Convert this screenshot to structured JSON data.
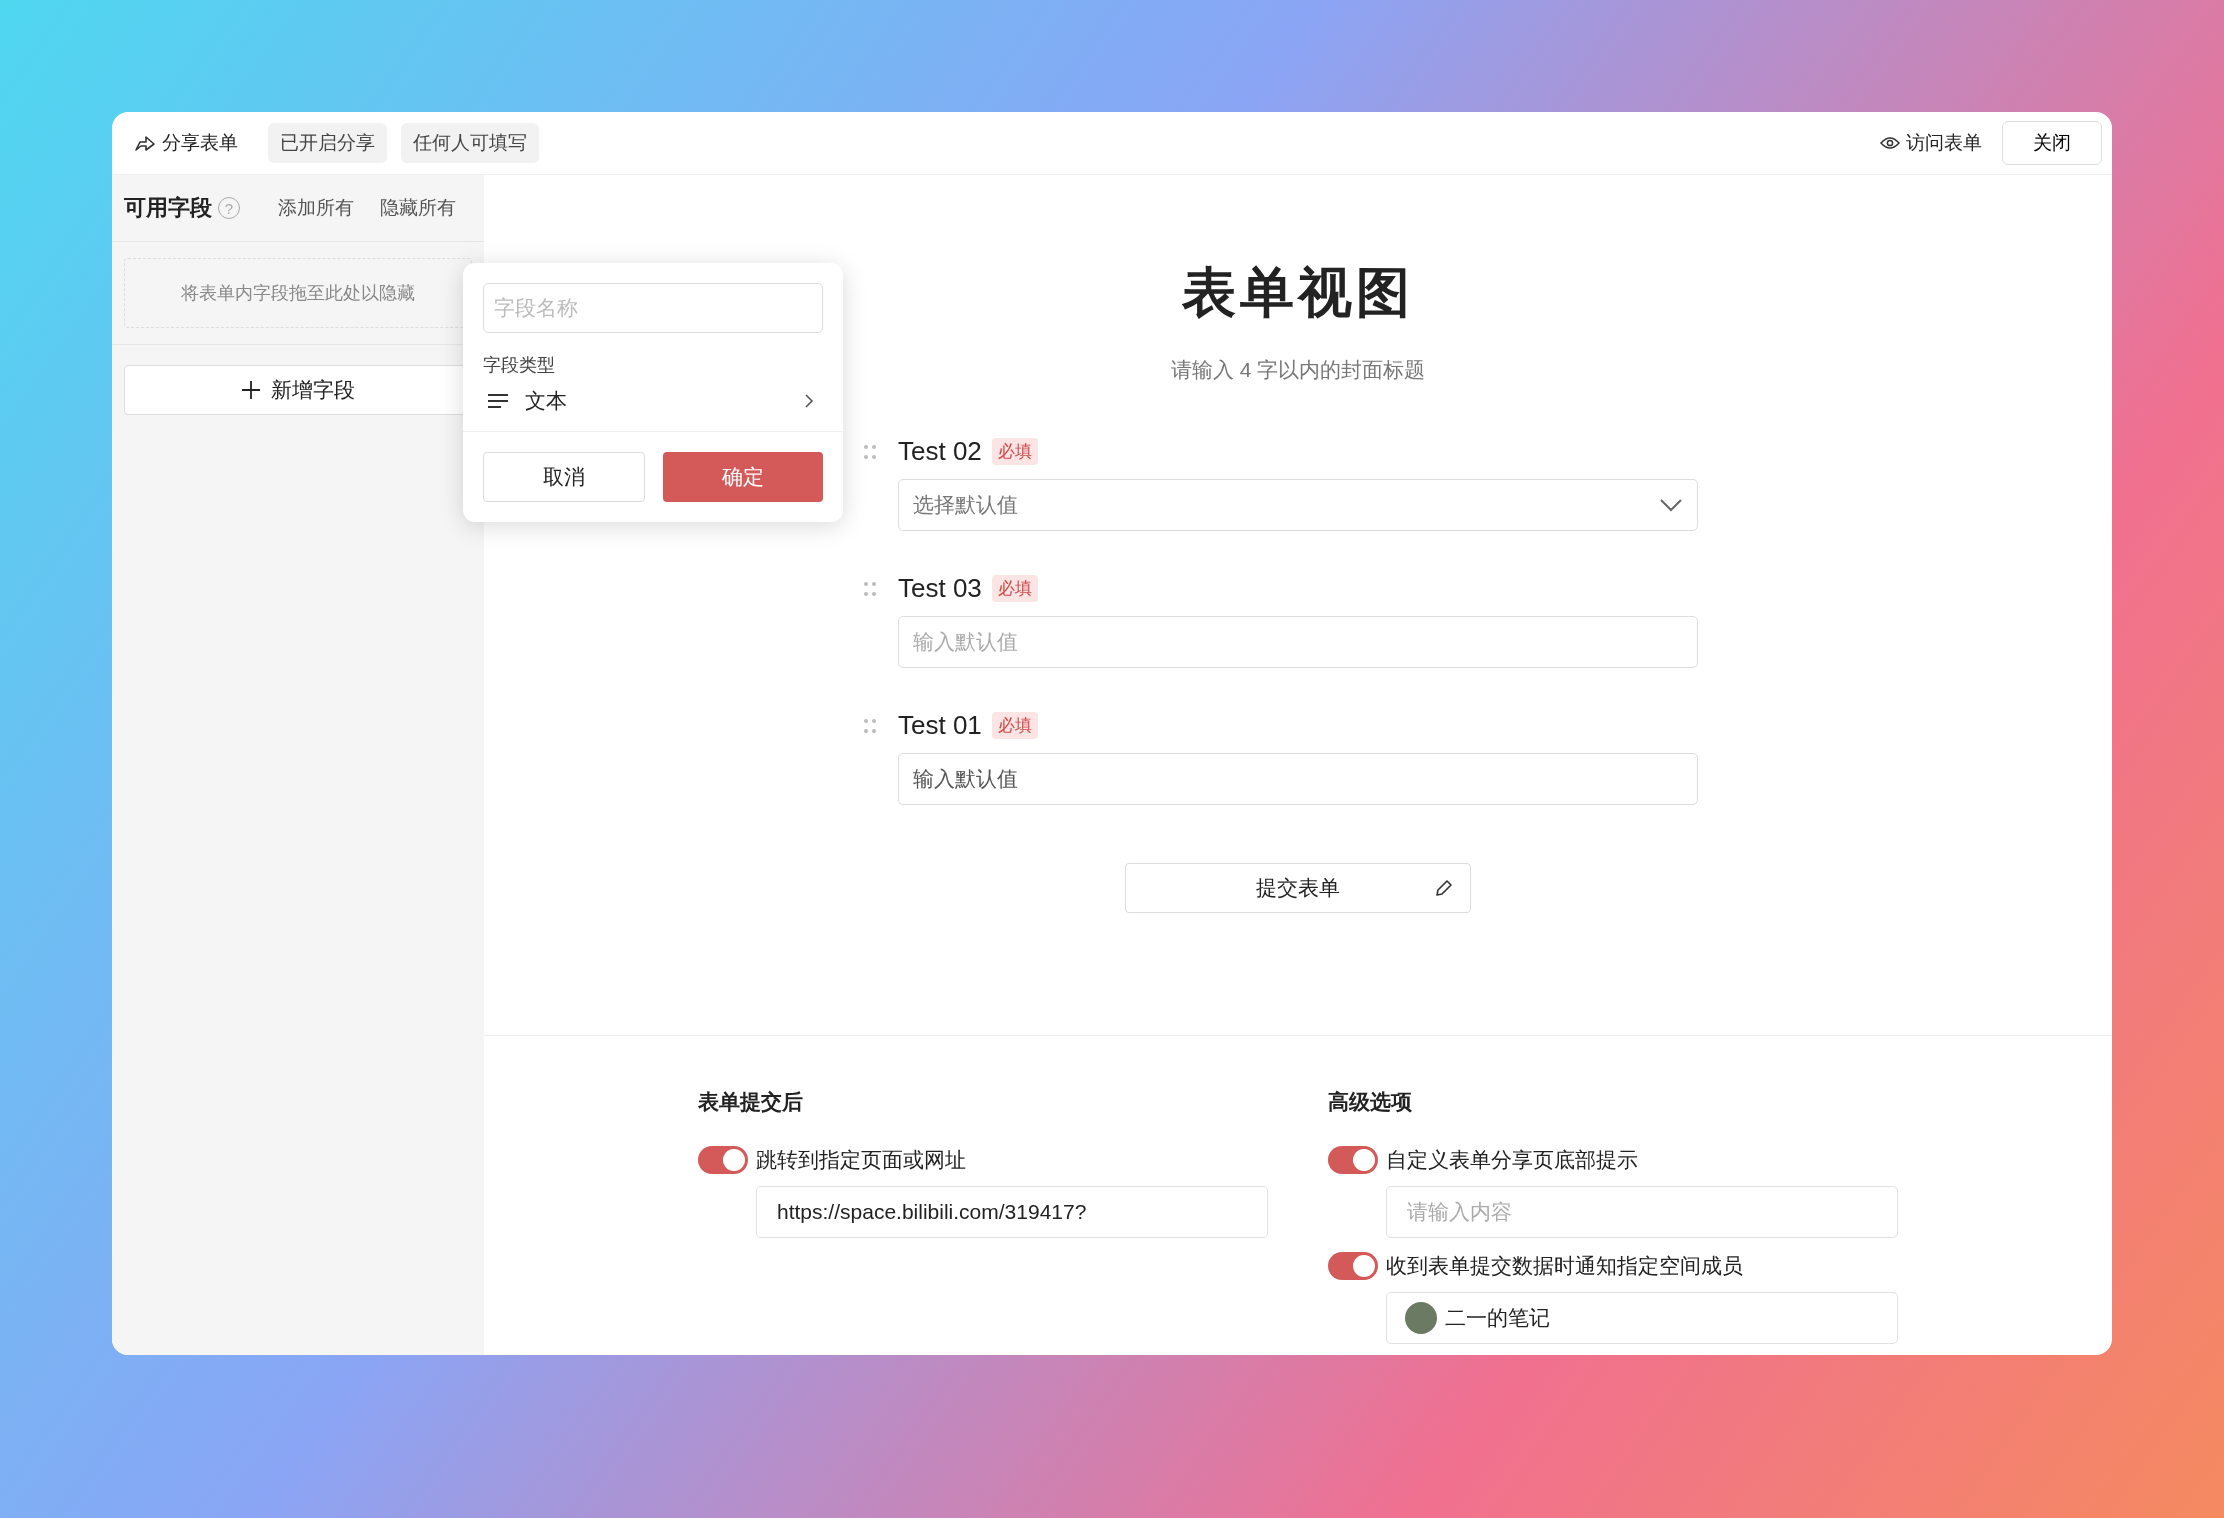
{
  "toolbar": {
    "share_label": "分享表单",
    "tags": [
      "已开启分享",
      "任何人可填写"
    ],
    "view_label": "访问表单",
    "close_label": "关闭"
  },
  "sidebar": {
    "title": "可用字段",
    "help": "?",
    "actions": [
      "添加所有",
      "隐藏所有"
    ],
    "drop_hint": "将表单内字段拖至此处以隐藏",
    "add_button": "新增字段"
  },
  "popover": {
    "name_placeholder": "字段名称",
    "type_label": "字段类型",
    "type_value": "文本",
    "cancel": "取消",
    "confirm": "确定"
  },
  "form": {
    "title": "表单视图",
    "subtitle": "请输入 4 字以内的封面标题",
    "fields": [
      {
        "label": "Test 02",
        "badge": "必填",
        "kind": "select",
        "placeholder": "选择默认值"
      },
      {
        "label": "Test 03",
        "badge": "必填",
        "kind": "text",
        "placeholder": "输入默认值"
      },
      {
        "label": "Test 01",
        "badge": "必填",
        "kind": "text",
        "value": "输入默认值"
      }
    ],
    "submit": "提交表单"
  },
  "settings": [
    {
      "title": "表单提交后",
      "options": [
        {
          "label": "跳转到指定页面或网址",
          "on": true,
          "kind": "text",
          "value": "https://space.bilibili.com/319417?"
        }
      ]
    },
    {
      "title": "高级选项",
      "options": [
        {
          "label": "自定义表单分享页底部提示",
          "on": true,
          "kind": "text",
          "placeholder": "请输入内容"
        },
        {
          "label": "收到表单提交数据时通知指定空间成员",
          "on": true,
          "kind": "member",
          "value": "二一的笔记"
        }
      ]
    }
  ]
}
